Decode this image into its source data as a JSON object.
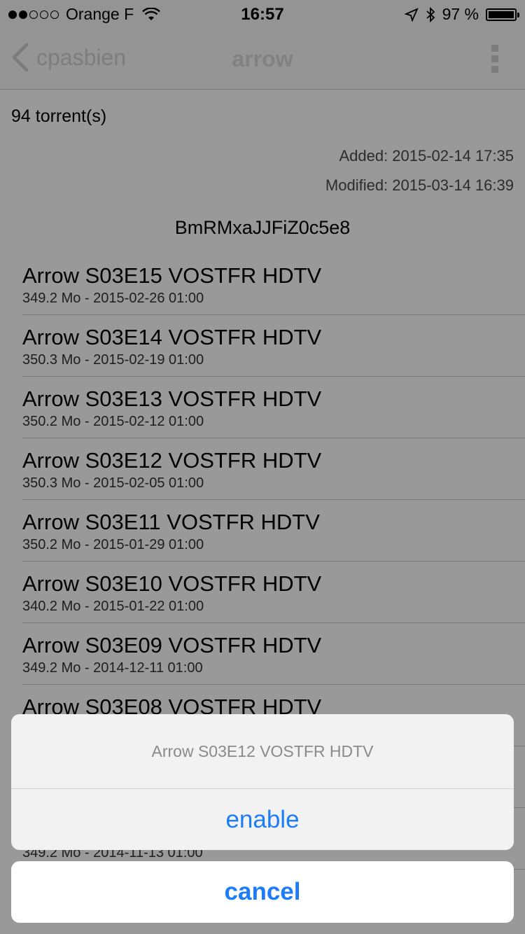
{
  "status_bar": {
    "carrier": "Orange F",
    "time": "16:57",
    "battery_percent": "97 %"
  },
  "nav": {
    "back_label": "cpasbien",
    "title": "arrow"
  },
  "info": {
    "count": "94 torrent(s)",
    "added": "Added: 2015-02-14 17:35",
    "modified": "Modified: 2015-03-14 16:39",
    "hash": "BmRMxaJJFiZ0c5e8"
  },
  "list": [
    {
      "title": "Arrow S03E15 VOSTFR HDTV",
      "sub": "349.2 Mo - 2015-02-26 01:00"
    },
    {
      "title": "Arrow S03E14 VOSTFR HDTV",
      "sub": "350.3 Mo - 2015-02-19 01:00"
    },
    {
      "title": "Arrow S03E13 VOSTFR HDTV",
      "sub": "350.2 Mo - 2015-02-12 01:00"
    },
    {
      "title": "Arrow S03E12 VOSTFR HDTV",
      "sub": "350.3 Mo - 2015-02-05 01:00"
    },
    {
      "title": "Arrow S03E11 VOSTFR HDTV",
      "sub": "350.2 Mo - 2015-01-29 01:00"
    },
    {
      "title": "Arrow S03E10 VOSTFR HDTV",
      "sub": "340.2 Mo - 2015-01-22 01:00"
    },
    {
      "title": "Arrow S03E09 VOSTFR HDTV",
      "sub": "349.2 Mo - 2014-12-11 01:00"
    },
    {
      "title": "Arrow S03E08 VOSTFR HDTV",
      "sub": ""
    },
    {
      "title": "",
      "sub": ""
    },
    {
      "title": "",
      "sub": "349.2 Mo - 2014-11-13 01:00"
    }
  ],
  "action_sheet": {
    "title": "Arrow S03E12 VOSTFR HDTV",
    "enable_label": "enable",
    "cancel_label": "cancel"
  },
  "colors": {
    "accent": "#1e7df6",
    "overlay": "rgba(0,0,0,0.40)"
  }
}
